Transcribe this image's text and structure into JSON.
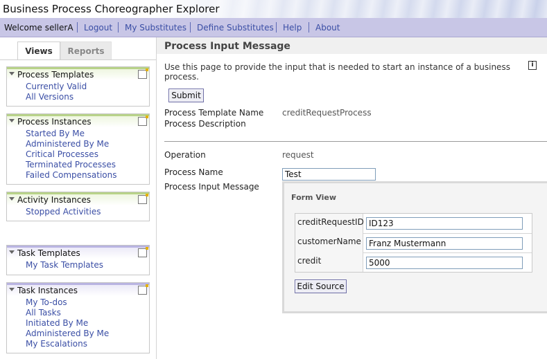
{
  "app": {
    "title": "Business Process Choreographer Explorer"
  },
  "nav": {
    "welcome": "Welcome sellerA",
    "links": [
      "Logout",
      "My Substitutes",
      "Define Substitutes",
      "Help",
      "About"
    ]
  },
  "sidebar": {
    "tabs": [
      "Views",
      "Reports"
    ],
    "panels": [
      {
        "title": "Process Templates",
        "links": [
          "Currently Valid",
          "All Versions"
        ]
      },
      {
        "title": "Process Instances",
        "links": [
          "Started By Me",
          "Administered By Me",
          "Critical Processes",
          "Terminated Processes",
          "Failed Compensations"
        ]
      },
      {
        "title": "Activity Instances",
        "links": [
          "Stopped Activities"
        ]
      },
      {
        "title": "Task Templates",
        "links": [
          "My Task Templates"
        ]
      },
      {
        "title": "Task Instances",
        "links": [
          "My To-dos",
          "All Tasks",
          "Initiated By Me",
          "Administered By Me",
          "My Escalations"
        ]
      }
    ]
  },
  "main": {
    "title": "Process Input Message",
    "description": "Use this page to provide the input that is needed to start an instance of a business process.",
    "info_icon": "i",
    "submit_label": "Submit",
    "template_name_label": "Process Template Name",
    "template_name_value": "creditRequestProcess",
    "description_label": "Process Description",
    "operation_label": "Operation",
    "operation_value": "request",
    "process_name_label": "Process Name",
    "process_name_value": "Test",
    "input_message_label": "Process Input Message",
    "form": {
      "title": "Form View",
      "fields": [
        {
          "label": "creditRequestID",
          "value": "ID123"
        },
        {
          "label": "customerName",
          "value": "Franz Mustermann"
        },
        {
          "label": "credit",
          "value": "5000"
        }
      ],
      "edit_source_label": "Edit Source"
    }
  },
  "colors": {
    "nav_bg": "#c8c6e6",
    "link": "#3a4ea5",
    "panel_green": "#b8d389",
    "panel_purple": "#b9b4e2"
  }
}
